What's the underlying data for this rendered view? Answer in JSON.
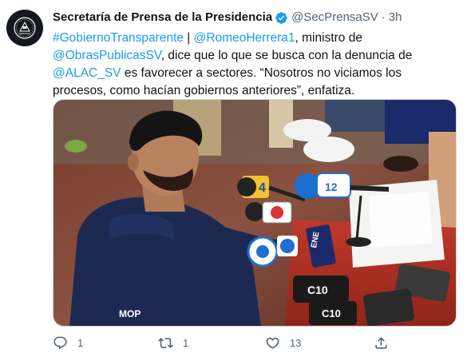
{
  "account": {
    "name": "Secretaría de Prensa de la Presidencia",
    "handle": "@SecPrensaSV",
    "separator": "·",
    "time": "3h",
    "verified": true,
    "avatar_icon": "presidential-seal-icon"
  },
  "tweet": {
    "parts": [
      {
        "text": "#GobiernoTransparente",
        "link": true
      },
      {
        "text": " | ",
        "link": false
      },
      {
        "text": "@RomeoHerrera1",
        "link": true
      },
      {
        "text": ", ministro de ",
        "link": false
      },
      {
        "text": "@ObrasPublicasSV",
        "link": true
      },
      {
        "text": ", dice que lo que se busca con la denuncia de ",
        "link": false
      },
      {
        "text": "@ALAC_SV",
        "link": true
      },
      {
        "text": " es favorecer a sectores. “Nosotros no viciamos los procesos, como hacían gobiernos anteriores”, enfatiza.",
        "link": false
      }
    ]
  },
  "media": {
    "description_icon": "press-conference-photo",
    "shirt_logo": "MOP",
    "mic_labels": [
      "4",
      "12",
      "ENE",
      "C10",
      "C10"
    ]
  },
  "actions": {
    "reply_count": "1",
    "retweet_count": "1",
    "like_count": "13",
    "reply_icon": "reply-icon",
    "retweet_icon": "retweet-icon",
    "like_icon": "heart-icon",
    "share_icon": "share-icon"
  },
  "colors": {
    "link": "#1d9bf0",
    "text": "#0f1419",
    "muted": "#536471",
    "verified": "#1d9bf0"
  }
}
